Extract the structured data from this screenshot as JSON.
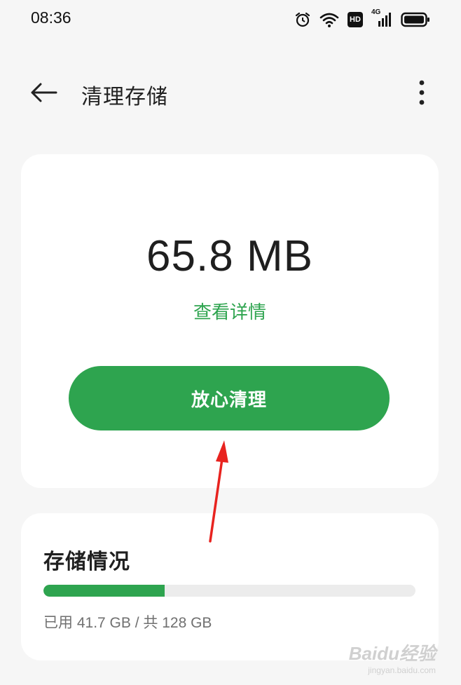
{
  "status_bar": {
    "time": "08:36",
    "icons": [
      "alarm-icon",
      "wifi-icon",
      "hd-icon",
      "cellular-4g-icon",
      "battery-icon"
    ],
    "hd_label": "HD",
    "network_label": "4G"
  },
  "app_bar": {
    "title": "清理存储",
    "back_icon": "arrow-left-icon",
    "more_icon": "more-vertical-icon"
  },
  "clean_card": {
    "junk_size": "65.8 MB",
    "details_link": "查看详情",
    "clean_button": "放心清理"
  },
  "storage_card": {
    "title": "存储情况",
    "usage_text": "已用 41.7 GB / 共 128 GB",
    "used_gb": 41.7,
    "total_gb": 128
  },
  "watermark": {
    "main": "Baidu经验",
    "sub": "jingyan.baidu.com"
  },
  "colors": {
    "accent": "#2ea44f",
    "background": "#f6f6f6",
    "card": "#ffffff",
    "annotation": "#e8231f"
  }
}
